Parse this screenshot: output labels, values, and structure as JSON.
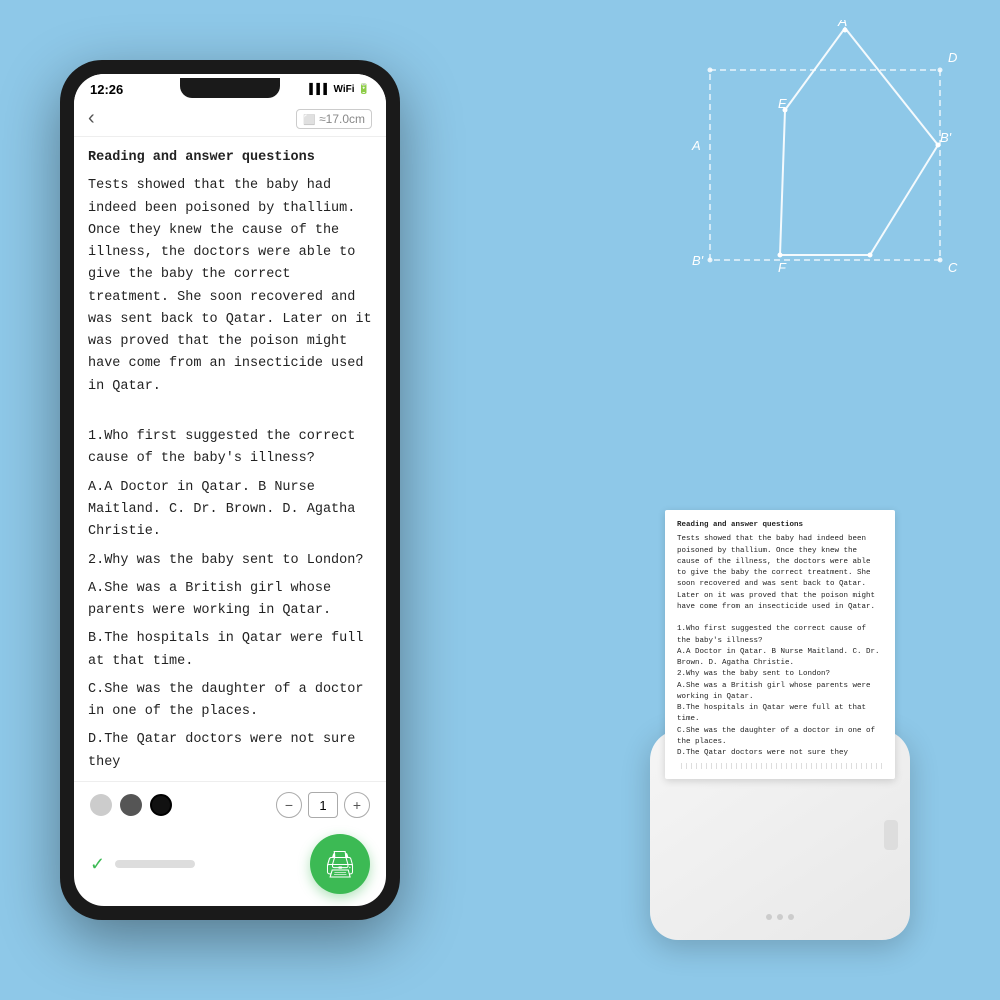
{
  "background": {
    "color": "#8ec8e8"
  },
  "phone": {
    "status": {
      "time": "12:26",
      "signal": "3/4G",
      "battery": "⬜"
    },
    "header": {
      "back_arrow": "‹",
      "ruler_label": "≈17.0cm"
    },
    "content": {
      "title": "Reading and answer questions",
      "paragraph1": "Tests showed that the baby had indeed been poisoned by thallium. Once they knew the cause of the illness, the doctors were able to give the baby the correct treatment. She soon recovered and was sent back to Qatar. Later on it was proved that the poison might have come from an insecticide used in Qatar.",
      "q1": "1.Who first suggested the correct cause of the baby's illness?",
      "q1_options": "A.A Doctor in Qatar.    B Nurse Maitland. C. Dr. Brown.    D. Agatha Christie.",
      "q2": "2.Why was the baby sent to London?",
      "q2_a": "A.She was a British girl whose parents were working in Qatar.",
      "q2_b": "B.The hospitals in Qatar were full at that time.",
      "q2_c": "C.She was the daughter of a doctor in one of the places.",
      "q2_d": "D.The Qatar doctors were not sure they"
    },
    "controls": {
      "minus": "−",
      "count": "1",
      "plus": "+"
    },
    "print_icon": "🖨"
  },
  "printer": {
    "paper": {
      "title": "Reading and answer questions",
      "text1": "Tests showed that the baby had indeed been poisoned by thallium. Once they knew the cause of the illness, the doctors were able to give the baby the correct treatment. She soon recovered and was sent back to Qatar. Later on it was proved that the poison might have come from an insecticide used in Qatar.",
      "q1": "1.Who first suggested the correct cause of the baby's illness?",
      "q1_options": "A.A Doctor in Qatar.    B Nurse Maitland. C. Dr. Brown.    D. Agatha Christie.",
      "q2": "2.Why was the baby sent to London?",
      "q2_a": "A.She was a British girl whose parents were working in Qatar.",
      "q2_b": "B.The hospitals in Qatar were full at that time.",
      "q2_c": "C.She was the daughter of a doctor in one of the places.",
      "q2_d": "D.The Qatar doctors were not sure they"
    }
  },
  "geometry": {
    "labels": {
      "A_prime": "A'",
      "E": "E",
      "B_prime": "B'",
      "D": "D",
      "A": "A",
      "B": "B",
      "F": "F",
      "C": "C"
    }
  }
}
